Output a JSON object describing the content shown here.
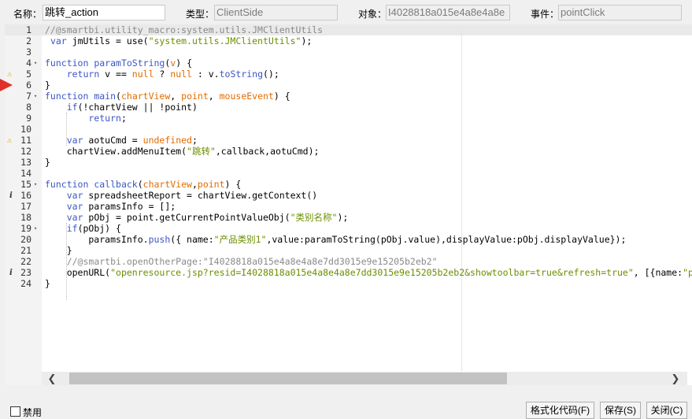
{
  "header": {
    "name_label": "名称：",
    "name_value": "跳转_action",
    "type_label": "类型：",
    "type_value": "ClientSide",
    "object_label": "对象：",
    "object_value": "I4028818a015e4a8e4a8e",
    "event_label": "事件：",
    "event_value": "pointClick"
  },
  "editor": {
    "lines": [
      {
        "n": "1",
        "fold": "",
        "marker": "",
        "html": "<span class=\"cm\">//@smartbi.utility_macro:system.utils.JMClientUtils</span>"
      },
      {
        "n": "2",
        "fold": "",
        "marker": "",
        "html": " <span class=\"kw\">var</span> jmUtils = use(<span class=\"str\">\"system.utils.JMClientUtils\"</span>);"
      },
      {
        "n": "3",
        "fold": "",
        "marker": "",
        "html": ""
      },
      {
        "n": "4",
        "fold": "▾",
        "marker": "",
        "html": "<span class=\"kw\">function</span> <span class=\"fn\">paramToString</span>(<span class=\"prm\">v</span>) {"
      },
      {
        "n": "5",
        "fold": "",
        "marker": "warn",
        "html": "    <span class=\"kw\">return</span> v == <span class=\"lit\">null</span> ? <span class=\"lit\">null</span> : v.<span class=\"met\">toString</span>();"
      },
      {
        "n": "6",
        "fold": "",
        "marker": "",
        "html": "}"
      },
      {
        "n": "7",
        "fold": "▾",
        "marker": "",
        "html": "<span class=\"kw\">function</span> <span class=\"fn\">main</span>(<span class=\"prm\">chartView</span>, <span class=\"prm\">point</span>, <span class=\"prm\">mouseEvent</span>) {"
      },
      {
        "n": "8",
        "fold": "",
        "marker": "",
        "html": "    <span class=\"kw\">if</span>(!chartView || !point)"
      },
      {
        "n": "9",
        "fold": "",
        "marker": "",
        "html": "        <span class=\"kw\">return</span>;"
      },
      {
        "n": "10",
        "fold": "",
        "marker": "",
        "html": ""
      },
      {
        "n": "11",
        "fold": "",
        "marker": "warn",
        "html": "    <span class=\"kw\">var</span> aotuCmd = <span class=\"lit\">undefined</span>;"
      },
      {
        "n": "12",
        "fold": "",
        "marker": "",
        "html": "    chartView.addMenuItem(<span class=\"str\">\"跳转\"</span>,callback,aotuCmd);"
      },
      {
        "n": "13",
        "fold": "",
        "marker": "",
        "html": "}"
      },
      {
        "n": "14",
        "fold": "",
        "marker": "",
        "html": ""
      },
      {
        "n": "15",
        "fold": "▾",
        "marker": "",
        "html": "<span class=\"kw\">function</span> <span class=\"fn\">callback</span>(<span class=\"prm\">chartView</span>,<span class=\"prm\">point</span>) {"
      },
      {
        "n": "16",
        "fold": "",
        "marker": "info",
        "html": "    <span class=\"kw\">var</span> spreadsheetReport = chartView.getContext()"
      },
      {
        "n": "17",
        "fold": "",
        "marker": "",
        "html": "    <span class=\"kw\">var</span> paramsInfo = [];"
      },
      {
        "n": "18",
        "fold": "",
        "marker": "",
        "html": "    <span class=\"kw\">var</span> pObj = point.getCurrentPointValueObj(<span class=\"str\">\"类别名称\"</span>);"
      },
      {
        "n": "19",
        "fold": "▾",
        "marker": "",
        "html": "    <span class=\"kw\">if</span>(pObj) {"
      },
      {
        "n": "20",
        "fold": "",
        "marker": "",
        "html": "        paramsInfo.<span class=\"met\">push</span>({ name:<span class=\"str\">\"产品类别1\"</span>,value:paramToString(pObj.value),displayValue:pObj.displayValue});"
      },
      {
        "n": "21",
        "fold": "",
        "marker": "",
        "html": "    }"
      },
      {
        "n": "22",
        "fold": "",
        "marker": "",
        "html": "    <span class=\"cm\">//@smartbi.openOtherPage:\"I4028818a015e4a8e4a8e7dd3015e9e15205b2eb2\"</span>"
      },
      {
        "n": "23",
        "fold": "",
        "marker": "info",
        "html": "    openURL(<span class=\"str\">\"openresource.jsp?resid=I4028818a015e4a8e4a8e7dd3015e9e15205b2eb2&amp;showtoolbar=true&amp;refresh=true\"</span>, [{name:<span class=\"str\">\"paramsI</span>"
      },
      {
        "n": "24",
        "fold": "",
        "marker": "",
        "html": "}"
      }
    ]
  },
  "icons": {
    "warn": "⚠",
    "info": "i",
    "scroll_left": "❮",
    "scroll_right": "❯"
  },
  "footer": {
    "disable_label": "禁用",
    "format_button": "格式化代码(F)",
    "save_button": "保存(S)",
    "close_button": "关闭(C)"
  }
}
